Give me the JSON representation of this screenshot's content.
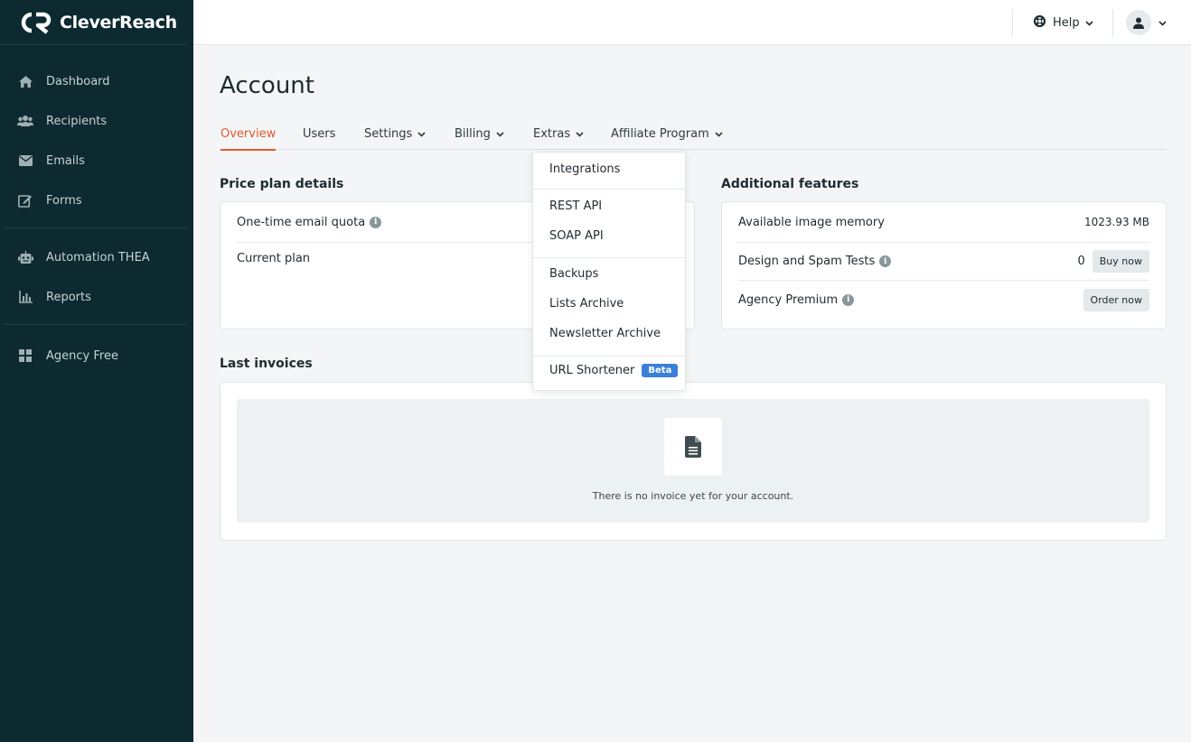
{
  "brand": {
    "name": "CleverReach",
    "accent": "#e4572e",
    "sidebar_bg": "#0c2a2f"
  },
  "sidebar": {
    "items": [
      {
        "label": "Dashboard",
        "icon": "home-icon"
      },
      {
        "label": "Recipients",
        "icon": "users-icon"
      },
      {
        "label": "Emails",
        "icon": "envelope-icon"
      },
      {
        "label": "Forms",
        "icon": "edit-icon"
      },
      {
        "label": "Automation THEA",
        "icon": "robot-icon"
      },
      {
        "label": "Reports",
        "icon": "chart-icon"
      },
      {
        "label": "Agency Free",
        "icon": "grid-icon"
      }
    ]
  },
  "topbar": {
    "help_label": "Help"
  },
  "page": {
    "title": "Account"
  },
  "tabs": [
    {
      "label": "Overview",
      "active": true
    },
    {
      "label": "Users"
    },
    {
      "label": "Settings"
    },
    {
      "label": "Billing"
    },
    {
      "label": "Extras"
    },
    {
      "label": "Affiliate Program"
    }
  ],
  "price_plan": {
    "title": "Price plan details",
    "rows": [
      {
        "label": "One-time email quota"
      },
      {
        "label": "Current plan"
      }
    ]
  },
  "additional": {
    "title": "Additional features",
    "rows": [
      {
        "label": "Available image memory",
        "value": "1023.93 MB"
      },
      {
        "label": "Design and Spam Tests",
        "value": "0",
        "button": "Buy now"
      },
      {
        "label": "Agency Premium",
        "button": "Order now"
      }
    ]
  },
  "invoices": {
    "title": "Last invoices",
    "empty_text": "There is no invoice yet for your account."
  },
  "extras_menu": {
    "items": [
      {
        "label": "Integrations"
      },
      {
        "label": "REST API"
      },
      {
        "label": "SOAP API"
      },
      {
        "label": "Backups"
      },
      {
        "label": "Lists Archive"
      },
      {
        "label": "Newsletter Archive"
      },
      {
        "label": "URL Shortener",
        "badge": "Beta"
      }
    ]
  }
}
